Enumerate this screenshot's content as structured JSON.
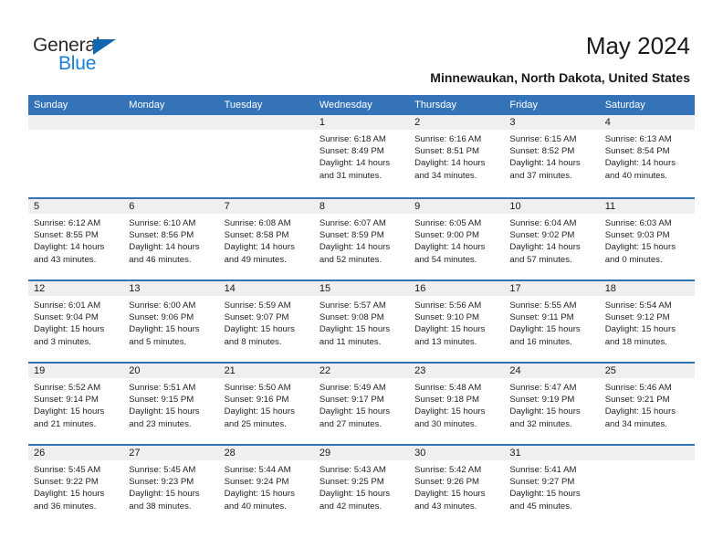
{
  "brand": {
    "name_top": "General",
    "name_bottom": "Blue",
    "triangle_color": "#1166b0",
    "blue_text_color": "#1a7fd4"
  },
  "header": {
    "title": "May 2024",
    "subtitle": "Minnewaukan, North Dakota, United States"
  },
  "theme": {
    "header_row_bg": "#3573b9",
    "header_row_text": "#ffffff",
    "date_band_bg": "#efefef",
    "cell_bg": "#ffffff",
    "row_divider": "#3573b9",
    "body_text": "#252525"
  },
  "weekdays": [
    "Sunday",
    "Monday",
    "Tuesday",
    "Wednesday",
    "Thursday",
    "Friday",
    "Saturday"
  ],
  "labels": {
    "sunrise": "Sunrise:",
    "sunset": "Sunset:",
    "daylight": "Daylight:"
  },
  "weeks": [
    [
      {
        "day": "",
        "sunrise": "",
        "sunset": "",
        "daylight_line1": "",
        "daylight_line2": "",
        "empty": true
      },
      {
        "day": "",
        "sunrise": "",
        "sunset": "",
        "daylight_line1": "",
        "daylight_line2": "",
        "empty": true
      },
      {
        "day": "",
        "sunrise": "",
        "sunset": "",
        "daylight_line1": "",
        "daylight_line2": "",
        "empty": true
      },
      {
        "day": "1",
        "sunrise": "Sunrise: 6:18 AM",
        "sunset": "Sunset: 8:49 PM",
        "daylight_line1": "Daylight: 14 hours",
        "daylight_line2": "and 31 minutes."
      },
      {
        "day": "2",
        "sunrise": "Sunrise: 6:16 AM",
        "sunset": "Sunset: 8:51 PM",
        "daylight_line1": "Daylight: 14 hours",
        "daylight_line2": "and 34 minutes."
      },
      {
        "day": "3",
        "sunrise": "Sunrise: 6:15 AM",
        "sunset": "Sunset: 8:52 PM",
        "daylight_line1": "Daylight: 14 hours",
        "daylight_line2": "and 37 minutes."
      },
      {
        "day": "4",
        "sunrise": "Sunrise: 6:13 AM",
        "sunset": "Sunset: 8:54 PM",
        "daylight_line1": "Daylight: 14 hours",
        "daylight_line2": "and 40 minutes."
      }
    ],
    [
      {
        "day": "5",
        "sunrise": "Sunrise: 6:12 AM",
        "sunset": "Sunset: 8:55 PM",
        "daylight_line1": "Daylight: 14 hours",
        "daylight_line2": "and 43 minutes."
      },
      {
        "day": "6",
        "sunrise": "Sunrise: 6:10 AM",
        "sunset": "Sunset: 8:56 PM",
        "daylight_line1": "Daylight: 14 hours",
        "daylight_line2": "and 46 minutes."
      },
      {
        "day": "7",
        "sunrise": "Sunrise: 6:08 AM",
        "sunset": "Sunset: 8:58 PM",
        "daylight_line1": "Daylight: 14 hours",
        "daylight_line2": "and 49 minutes."
      },
      {
        "day": "8",
        "sunrise": "Sunrise: 6:07 AM",
        "sunset": "Sunset: 8:59 PM",
        "daylight_line1": "Daylight: 14 hours",
        "daylight_line2": "and 52 minutes."
      },
      {
        "day": "9",
        "sunrise": "Sunrise: 6:05 AM",
        "sunset": "Sunset: 9:00 PM",
        "daylight_line1": "Daylight: 14 hours",
        "daylight_line2": "and 54 minutes."
      },
      {
        "day": "10",
        "sunrise": "Sunrise: 6:04 AM",
        "sunset": "Sunset: 9:02 PM",
        "daylight_line1": "Daylight: 14 hours",
        "daylight_line2": "and 57 minutes."
      },
      {
        "day": "11",
        "sunrise": "Sunrise: 6:03 AM",
        "sunset": "Sunset: 9:03 PM",
        "daylight_line1": "Daylight: 15 hours",
        "daylight_line2": "and 0 minutes."
      }
    ],
    [
      {
        "day": "12",
        "sunrise": "Sunrise: 6:01 AM",
        "sunset": "Sunset: 9:04 PM",
        "daylight_line1": "Daylight: 15 hours",
        "daylight_line2": "and 3 minutes."
      },
      {
        "day": "13",
        "sunrise": "Sunrise: 6:00 AM",
        "sunset": "Sunset: 9:06 PM",
        "daylight_line1": "Daylight: 15 hours",
        "daylight_line2": "and 5 minutes."
      },
      {
        "day": "14",
        "sunrise": "Sunrise: 5:59 AM",
        "sunset": "Sunset: 9:07 PM",
        "daylight_line1": "Daylight: 15 hours",
        "daylight_line2": "and 8 minutes."
      },
      {
        "day": "15",
        "sunrise": "Sunrise: 5:57 AM",
        "sunset": "Sunset: 9:08 PM",
        "daylight_line1": "Daylight: 15 hours",
        "daylight_line2": "and 11 minutes."
      },
      {
        "day": "16",
        "sunrise": "Sunrise: 5:56 AM",
        "sunset": "Sunset: 9:10 PM",
        "daylight_line1": "Daylight: 15 hours",
        "daylight_line2": "and 13 minutes."
      },
      {
        "day": "17",
        "sunrise": "Sunrise: 5:55 AM",
        "sunset": "Sunset: 9:11 PM",
        "daylight_line1": "Daylight: 15 hours",
        "daylight_line2": "and 16 minutes."
      },
      {
        "day": "18",
        "sunrise": "Sunrise: 5:54 AM",
        "sunset": "Sunset: 9:12 PM",
        "daylight_line1": "Daylight: 15 hours",
        "daylight_line2": "and 18 minutes."
      }
    ],
    [
      {
        "day": "19",
        "sunrise": "Sunrise: 5:52 AM",
        "sunset": "Sunset: 9:14 PM",
        "daylight_line1": "Daylight: 15 hours",
        "daylight_line2": "and 21 minutes."
      },
      {
        "day": "20",
        "sunrise": "Sunrise: 5:51 AM",
        "sunset": "Sunset: 9:15 PM",
        "daylight_line1": "Daylight: 15 hours",
        "daylight_line2": "and 23 minutes."
      },
      {
        "day": "21",
        "sunrise": "Sunrise: 5:50 AM",
        "sunset": "Sunset: 9:16 PM",
        "daylight_line1": "Daylight: 15 hours",
        "daylight_line2": "and 25 minutes."
      },
      {
        "day": "22",
        "sunrise": "Sunrise: 5:49 AM",
        "sunset": "Sunset: 9:17 PM",
        "daylight_line1": "Daylight: 15 hours",
        "daylight_line2": "and 27 minutes."
      },
      {
        "day": "23",
        "sunrise": "Sunrise: 5:48 AM",
        "sunset": "Sunset: 9:18 PM",
        "daylight_line1": "Daylight: 15 hours",
        "daylight_line2": "and 30 minutes."
      },
      {
        "day": "24",
        "sunrise": "Sunrise: 5:47 AM",
        "sunset": "Sunset: 9:19 PM",
        "daylight_line1": "Daylight: 15 hours",
        "daylight_line2": "and 32 minutes."
      },
      {
        "day": "25",
        "sunrise": "Sunrise: 5:46 AM",
        "sunset": "Sunset: 9:21 PM",
        "daylight_line1": "Daylight: 15 hours",
        "daylight_line2": "and 34 minutes."
      }
    ],
    [
      {
        "day": "26",
        "sunrise": "Sunrise: 5:45 AM",
        "sunset": "Sunset: 9:22 PM",
        "daylight_line1": "Daylight: 15 hours",
        "daylight_line2": "and 36 minutes."
      },
      {
        "day": "27",
        "sunrise": "Sunrise: 5:45 AM",
        "sunset": "Sunset: 9:23 PM",
        "daylight_line1": "Daylight: 15 hours",
        "daylight_line2": "and 38 minutes."
      },
      {
        "day": "28",
        "sunrise": "Sunrise: 5:44 AM",
        "sunset": "Sunset: 9:24 PM",
        "daylight_line1": "Daylight: 15 hours",
        "daylight_line2": "and 40 minutes."
      },
      {
        "day": "29",
        "sunrise": "Sunrise: 5:43 AM",
        "sunset": "Sunset: 9:25 PM",
        "daylight_line1": "Daylight: 15 hours",
        "daylight_line2": "and 42 minutes."
      },
      {
        "day": "30",
        "sunrise": "Sunrise: 5:42 AM",
        "sunset": "Sunset: 9:26 PM",
        "daylight_line1": "Daylight: 15 hours",
        "daylight_line2": "and 43 minutes."
      },
      {
        "day": "31",
        "sunrise": "Sunrise: 5:41 AM",
        "sunset": "Sunset: 9:27 PM",
        "daylight_line1": "Daylight: 15 hours",
        "daylight_line2": "and 45 minutes."
      },
      {
        "day": "",
        "sunrise": "",
        "sunset": "",
        "daylight_line1": "",
        "daylight_line2": "",
        "empty": true
      }
    ]
  ]
}
